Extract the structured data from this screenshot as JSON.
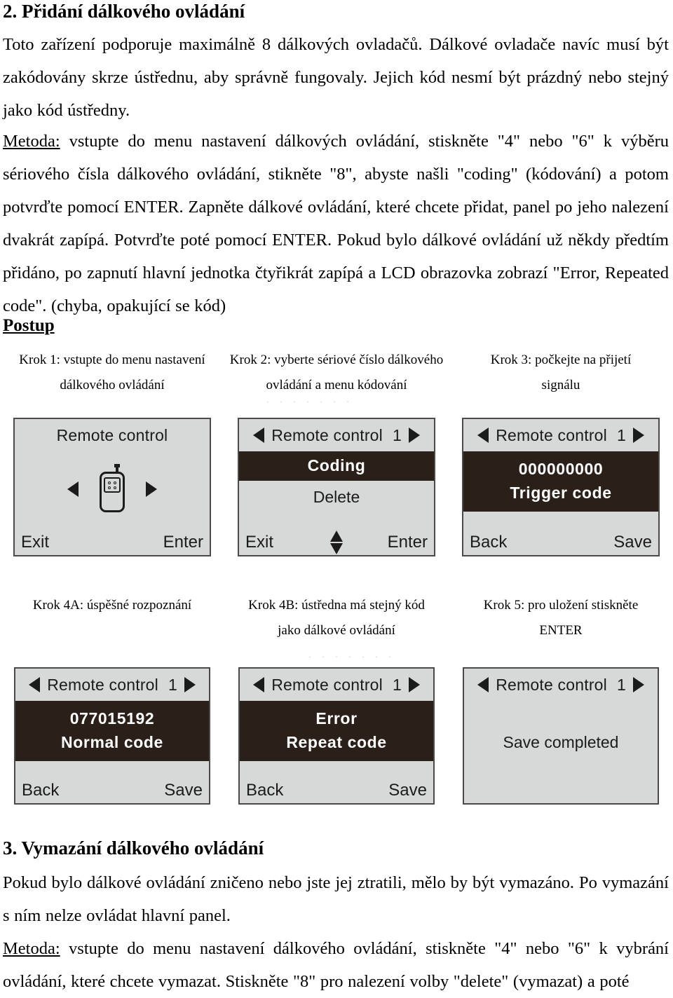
{
  "doc": {
    "heading_1": "2. Přidání dálkového ovládání",
    "intro_paragraph": "Toto zařízení podporuje maximálně 8 dálkových ovladačů. Dálkové ovladače navíc musí být zakódovány skrze ústřednu, aby správně fungovaly. Jejich kód nesmí být prázdný nebo stejný jako kód ústředny.",
    "method_label": "Metoda:",
    "method_paragraph": " vstupte do menu nastavení dálkových ovládání, stiskněte \"4\" nebo \"6\" k výběru sériového čísla dálkového ovládání, stikněte \"8\", abyste našli \"coding\" (kódování) a potom potvrďte pomocí ENTER. Zapněte dálkové ovládání, které chcete přidat, panel po jeho nalezení dvakrát zapípá. Potvrďte poté pomocí ENTER. Pokud bylo dálkové ovládání už někdy předtím přidáno, po zapnutí hlavní jednotka čtyřikrát zapípá a LCD obrazovka zobrazí \"Error, Repeated code\". (chyba, opakující se kód)",
    "procedure_heading": "Postup",
    "heading_3": "3. Vymazání dálkového ovládání",
    "delete_paragraph": "Pokud bylo dálkové ovládání zničeno nebo jste jej ztratili, mělo by být vymazáno. Po vymazání s ním nelze ovládat hlavní panel.",
    "delete_method_label": "Metoda:",
    "delete_method_paragraph": " vstupte do menu nastavení dálkového ovládání, stiskněte \"4\" nebo \"6\" k vybrání ovládání, které chcete vymazat. Stiskněte \"8\" pro nalezení volby \"delete\" (vymazat) a poté"
  },
  "steps_row1": [
    {
      "line1": "Krok 1: vstupte do menu nastavení",
      "line2": "dálkového ovládání"
    },
    {
      "line1": "Krok 2: vyberte sériové číslo dálkového",
      "line2": "ovládání a menu kódování"
    },
    {
      "line1": "Krok 3: počkejte na přijetí",
      "line2": "signálu"
    }
  ],
  "steps_row2": [
    {
      "line1": "Krok 4A: úspěšné rozpoznání",
      "line2": ""
    },
    {
      "line1": "Krok 4B: ústředna má stejný kód",
      "line2": "jako dálkové ovládání"
    },
    {
      "line1": "Krok 5: pro uložení stiskněte",
      "line2": "ENTER"
    }
  ],
  "lcd_screens": [
    {
      "id": "screen-remote-control-select",
      "title": "Remote control",
      "number": "",
      "hero_icon": "remote-control-icon",
      "left_arrow": "◀",
      "right_arrow": "▶",
      "footer_left": "Exit",
      "footer_right": "Enter",
      "footer_mid": ""
    },
    {
      "id": "screen-coding-menu",
      "title": "Remote control",
      "number": "1",
      "highlight_line": "Coding",
      "plain_line": "Delete",
      "left_arrow": "◀",
      "right_arrow": "▶",
      "footer_left": "Exit",
      "footer_right": "Enter",
      "footer_mid": "up-down-arrow"
    },
    {
      "id": "screen-trigger-code",
      "title": "Remote control",
      "number": "1",
      "band_line1": "000000000",
      "band_line2": "Trigger  code",
      "left_arrow": "◀",
      "right_arrow": "▶",
      "footer_left": "Back",
      "footer_right": "Save",
      "footer_mid": ""
    },
    {
      "id": "screen-normal-code",
      "title": "Remote control",
      "number": "1",
      "band_line1": "077015192",
      "band_line2": "Normal  code",
      "left_arrow": "◀",
      "right_arrow": "▶",
      "footer_left": "Back",
      "footer_right": "Save",
      "footer_mid": ""
    },
    {
      "id": "screen-error-repeat-code",
      "title": "Remote control",
      "number": "1",
      "band_line1": "Error",
      "band_line2": "Repeat  code",
      "left_arrow": "◀",
      "right_arrow": "▶",
      "footer_left": "Back",
      "footer_right": "Save",
      "footer_mid": ""
    },
    {
      "id": "screen-save-completed",
      "title": "Remote control",
      "number": "1",
      "plain_message": "Save  completed",
      "left_arrow": "◀",
      "right_arrow": "▶",
      "footer_left": "",
      "footer_right": "",
      "footer_mid": ""
    }
  ],
  "colors": {
    "lcd_background": "#d7d9d8",
    "lcd_border": "#4a4a4a",
    "lcd_highlight_band": "#2b2019",
    "lcd_highlight_text": "#ffffff",
    "page_background": "#ffffff",
    "text": "#000000"
  }
}
